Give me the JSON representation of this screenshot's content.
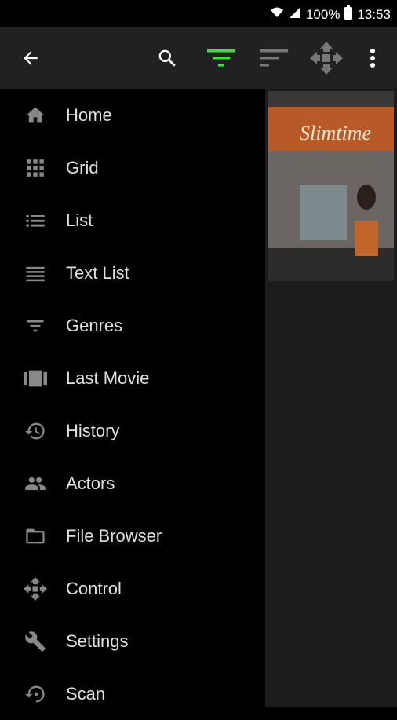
{
  "status": {
    "battery": "100%",
    "time": "13:53"
  },
  "toolbar": {
    "icons": [
      "back-arrow-icon",
      "search-icon",
      "filter-icon",
      "sort-icon",
      "remote-control-icon",
      "more-vert-icon"
    ],
    "accent": "#33e633"
  },
  "drawer": {
    "items": [
      {
        "label": "Home",
        "icon": "home-icon"
      },
      {
        "label": "Grid",
        "icon": "grid-icon"
      },
      {
        "label": "List",
        "icon": "list-icon"
      },
      {
        "label": "Text List",
        "icon": "text-list-icon"
      },
      {
        "label": "Genres",
        "icon": "genres-filter-icon"
      },
      {
        "label": "Last Movie",
        "icon": "last-movie-icon"
      },
      {
        "label": "History",
        "icon": "history-icon"
      },
      {
        "label": "Actors",
        "icon": "actors-icon"
      },
      {
        "label": "File Browser",
        "icon": "folder-icon"
      },
      {
        "label": "Control",
        "icon": "control-icon"
      },
      {
        "label": "Settings",
        "icon": "wrench-icon"
      },
      {
        "label": "Scan",
        "icon": "scan-icon"
      }
    ]
  },
  "content": {
    "poster_title": "Slimtime"
  }
}
